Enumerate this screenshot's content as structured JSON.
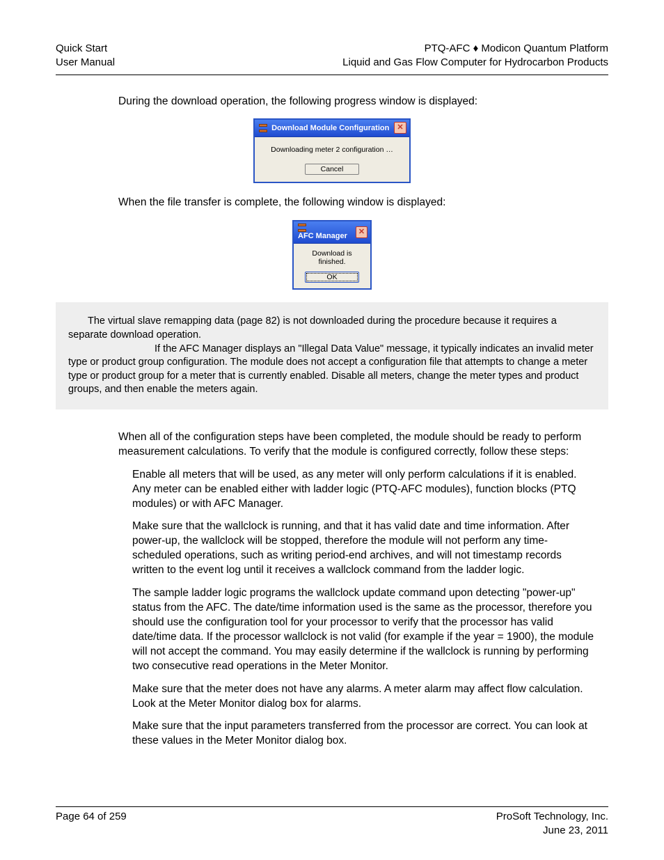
{
  "header": {
    "left_line1": "Quick Start",
    "left_line2": "User Manual",
    "right_line1": "PTQ-AFC ♦ Modicon Quantum Platform",
    "right_line2": "Liquid and Gas Flow Computer for Hydrocarbon Products"
  },
  "body": {
    "para1": "During the download operation, the following progress window is displayed:",
    "para2": "When the file transfer is complete, the following window is displayed:",
    "para3": "When all of the configuration steps have been completed, the module should be ready to perform measurement calculations. To verify that the module is configured correctly, follow these steps:",
    "step1": "Enable all meters that will be used, as any meter will only perform calculations if it is enabled. Any meter can be enabled either with ladder logic (PTQ-AFC modules), function blocks (PTQ modules) or with AFC Manager.",
    "step2": "Make sure that the wallclock is running, and that it has valid date and time information. After power-up, the wallclock will be stopped, therefore the module will not perform any time-scheduled operations, such as writing period-end archives, and will not timestamp records written to the event log until it receives a wallclock command from the ladder logic.",
    "step3": "The sample ladder logic programs the wallclock update command upon detecting \"power-up\" status from the AFC. The date/time information used is the same as the processor, therefore you should use the configuration tool for your processor to verify that the processor has valid date/time data. If the processor wallclock is not valid (for example if the year = 1900), the module will not accept the command. You may easily determine if the wallclock is running by performing two consecutive read operations in the Meter Monitor.",
    "step4": "Make sure that the meter does not have any alarms. A meter alarm may affect flow calculation. Look at the Meter Monitor dialog box for alarms.",
    "step5": "Make sure that the input parameters transferred from the processor are correct. You can look at these values in the Meter Monitor dialog box."
  },
  "dialog1": {
    "title": "Download Module Configuration",
    "message": "Downloading meter 2 configuration …",
    "cancel": "Cancel"
  },
  "dialog2": {
    "title": "AFC Manager",
    "message": "Download is finished.",
    "ok": "OK"
  },
  "notebox": {
    "p1": "The virtual slave remapping data (page 82) is not downloaded during the procedure because it requires a separate download operation.",
    "p2": "If the AFC Manager displays an \"Illegal Data Value\" message, it typically indicates an invalid meter type or product group configuration. The module does not accept a configuration file that attempts to change a meter type or product group for a meter that is currently enabled. Disable all meters, change the meter types and product groups, and then enable the meters again."
  },
  "footer": {
    "left": "Page 64 of 259",
    "right_line1": "ProSoft Technology, Inc.",
    "right_line2": "June 23, 2011"
  }
}
